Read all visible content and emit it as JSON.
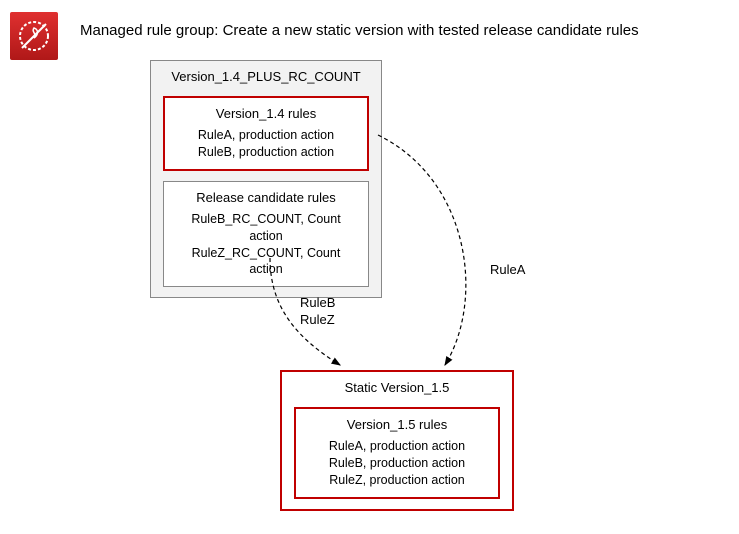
{
  "header": {
    "title": "Managed rule group: Create a new static version with tested release candidate rules",
    "icon_name": "waf-shield-icon"
  },
  "top_box": {
    "title": "Version_1.4_PLUS_RC_COUNT",
    "prod_rules": {
      "title": "Version_1.4 rules",
      "rules": [
        "RuleA, production action",
        "RuleB, production action"
      ]
    },
    "rc_rules": {
      "title": "Release candidate rules",
      "rules": [
        "RuleB_RC_COUNT, Count action",
        "RuleZ_RC_COUNT, Count action"
      ]
    }
  },
  "bottom_box": {
    "title": "Static Version_1.5",
    "inner": {
      "title": "Version_1.5 rules",
      "rules": [
        "RuleA, production action",
        "RuleB, production action",
        "RuleZ, production action"
      ]
    }
  },
  "arrows": {
    "left_label_1": "RuleB",
    "left_label_2": "RuleZ",
    "right_label": "RuleA"
  }
}
